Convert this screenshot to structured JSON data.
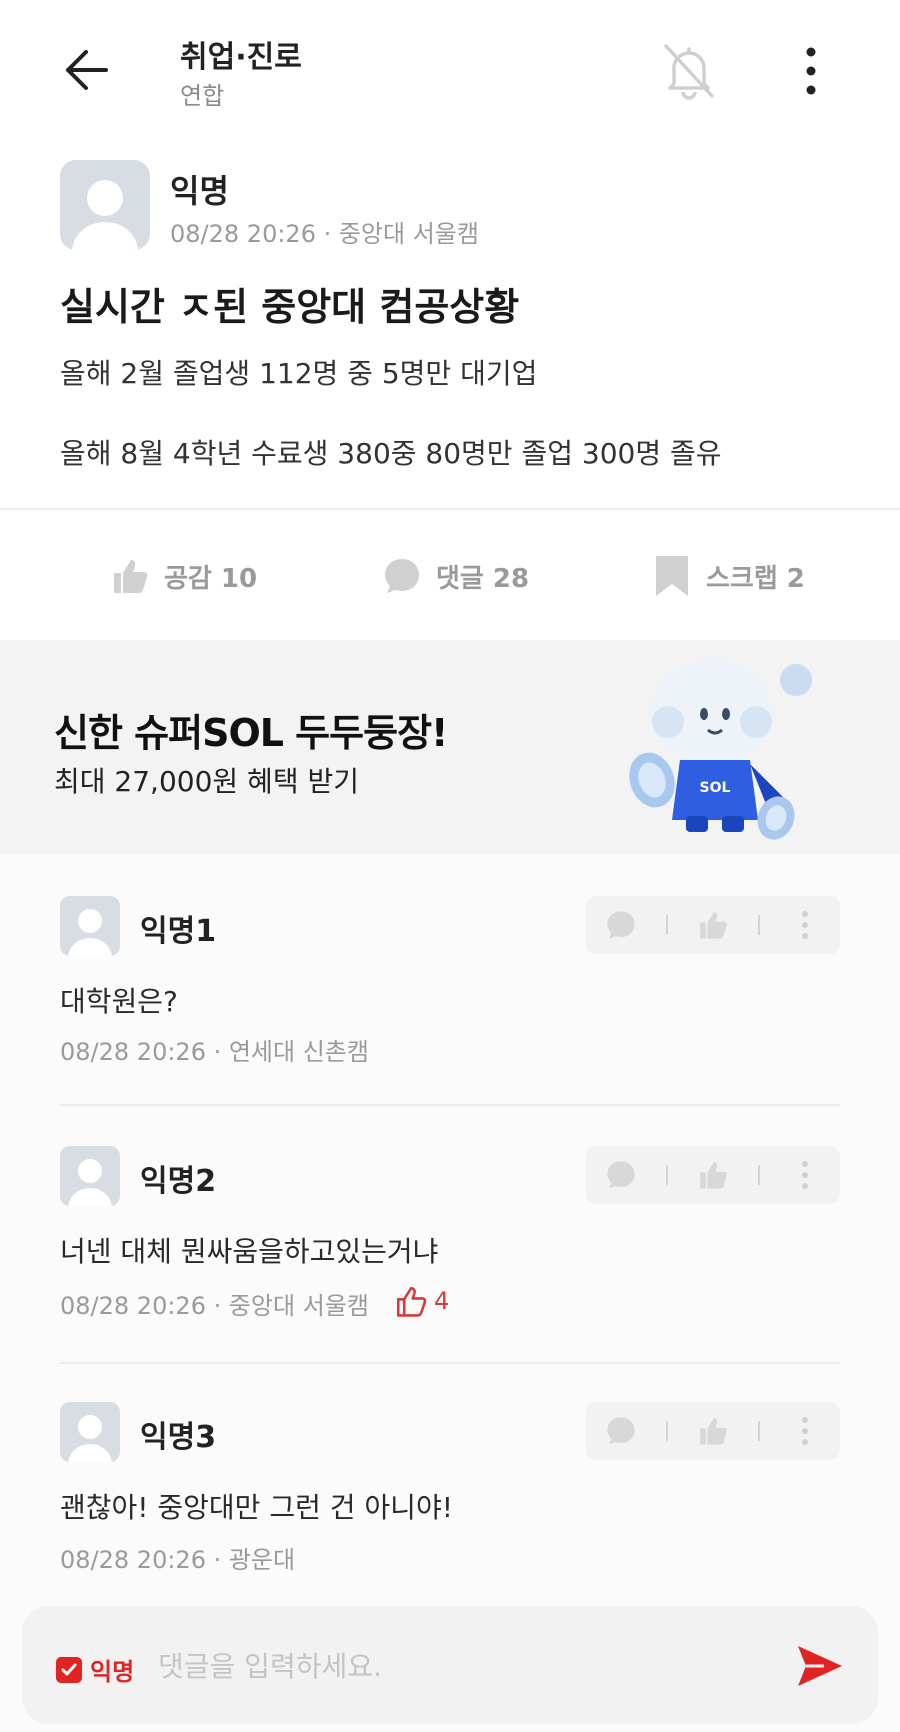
{
  "header": {
    "title": "취업·진로",
    "subtitle": "연합"
  },
  "post": {
    "author": "익명",
    "meta": "08/28 20:26 · 중앙대 서울캠",
    "title": "실시간 ㅈ된 중앙대 컴공상황",
    "body_lines": [
      "올해 2월 졸업생 112명 중 5명만 대기업",
      "올해 8월 4학년 수료생 380중 80명만 졸업 300명 졸유"
    ],
    "actions": {
      "like_label": "공감 10",
      "comment_label": "댓글 28",
      "scrap_label": "스크랩 2"
    }
  },
  "ad": {
    "title": "신한 슈퍼SOL 두두둥장!",
    "subtitle": "최대 27,000원 혜택 받기",
    "art_text": "SOL"
  },
  "comments": [
    {
      "author": "익명1",
      "text": "대학원은?",
      "meta": "08/28 20:26 · 연세대 신촌캠",
      "likes": ""
    },
    {
      "author": "익명2",
      "text": "너넨 대체 뭔싸움을하고있는거냐",
      "meta": "08/28 20:26 · 중앙대 서울캠",
      "likes": "4"
    },
    {
      "author": "익명3",
      "text": "괜찮아! 중앙대만 그런 건 아니야!",
      "meta": "08/28 20:26 · 광운대",
      "likes": ""
    }
  ],
  "composer": {
    "anon_label": "익명",
    "placeholder": "댓글을 입력하세요."
  },
  "colors": {
    "accent": "#e02424",
    "muted": "#9a9a9a",
    "avatar": "#d7dde2"
  }
}
